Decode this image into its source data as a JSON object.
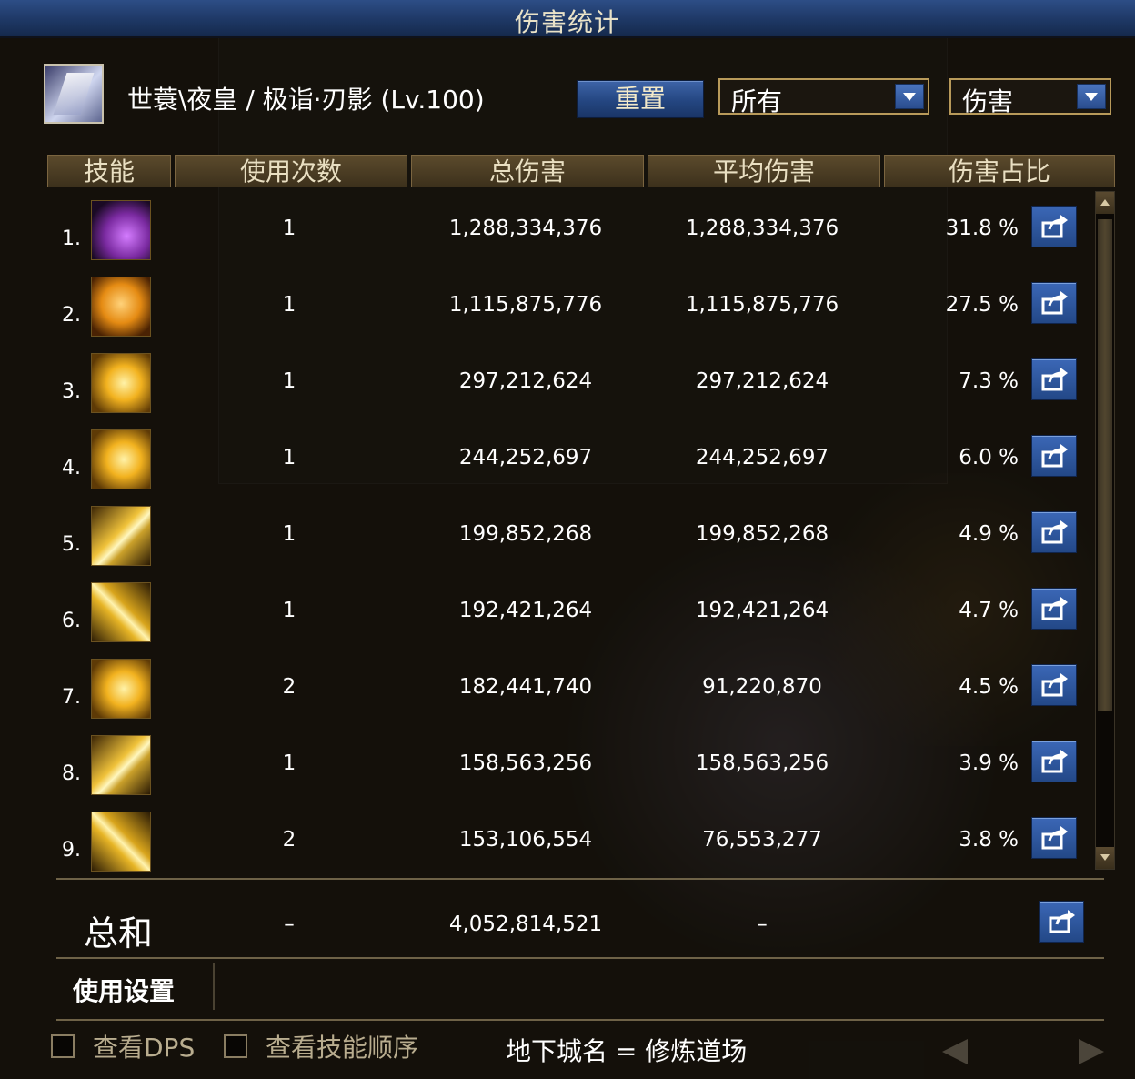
{
  "window": {
    "title": "伤害统计"
  },
  "header": {
    "character": "世蓑\\夜皇 / 极诣·刃影 (Lv.100)",
    "reset_label": "重置",
    "filter_dropdown": {
      "value": "所有"
    },
    "type_dropdown": {
      "value": "伤害"
    }
  },
  "table": {
    "columns": [
      "技能",
      "使用次数",
      "总伤害",
      "平均伤害",
      "伤害占比"
    ],
    "rows": [
      {
        "rank": "1.",
        "icon": "purple-slash-skill-icon",
        "uses": "1",
        "total": "1,288,334,376",
        "avg": "1,288,334,376",
        "pct": "31.8 %"
      },
      {
        "rank": "2.",
        "icon": "orange-crescent-skill-icon",
        "uses": "1",
        "total": "1,115,875,776",
        "avg": "1,115,875,776",
        "pct": "27.5 %"
      },
      {
        "rank": "3.",
        "icon": "gold-burst-skill-icon",
        "uses": "1",
        "total": "297,212,624",
        "avg": "297,212,624",
        "pct": "7.3 %"
      },
      {
        "rank": "4.",
        "icon": "gold-spiral-skill-icon",
        "uses": "1",
        "total": "244,252,697",
        "avg": "244,252,697",
        "pct": "6.0 %"
      },
      {
        "rank": "5.",
        "icon": "gold-rays-skill-icon",
        "uses": "1",
        "total": "199,852,268",
        "avg": "199,852,268",
        "pct": "4.9 %"
      },
      {
        "rank": "6.",
        "icon": "gold-diagonal-skill-icon",
        "uses": "1",
        "total": "192,421,264",
        "avg": "192,421,264",
        "pct": "4.7 %"
      },
      {
        "rank": "7.",
        "icon": "gold-star-skill-icon",
        "uses": "2",
        "total": "182,441,740",
        "avg": "91,220,870",
        "pct": "4.5 %"
      },
      {
        "rank": "8.",
        "icon": "gold-blade-skill-icon",
        "uses": "1",
        "total": "158,563,256",
        "avg": "158,563,256",
        "pct": "3.9 %"
      },
      {
        "rank": "9.",
        "icon": "gold-strike-skill-icon",
        "uses": "2",
        "total": "153,106,554",
        "avg": "76,553,277",
        "pct": "3.8 %"
      }
    ],
    "total": {
      "label": "总和",
      "uses": "–",
      "total": "4,052,814,521",
      "avg": "–"
    }
  },
  "settings_tab": "使用设置",
  "footer": {
    "view_dps": "查看DPS",
    "view_skill_order": "查看技能顺序",
    "dungeon": "地下城名 = 修炼道场"
  }
}
